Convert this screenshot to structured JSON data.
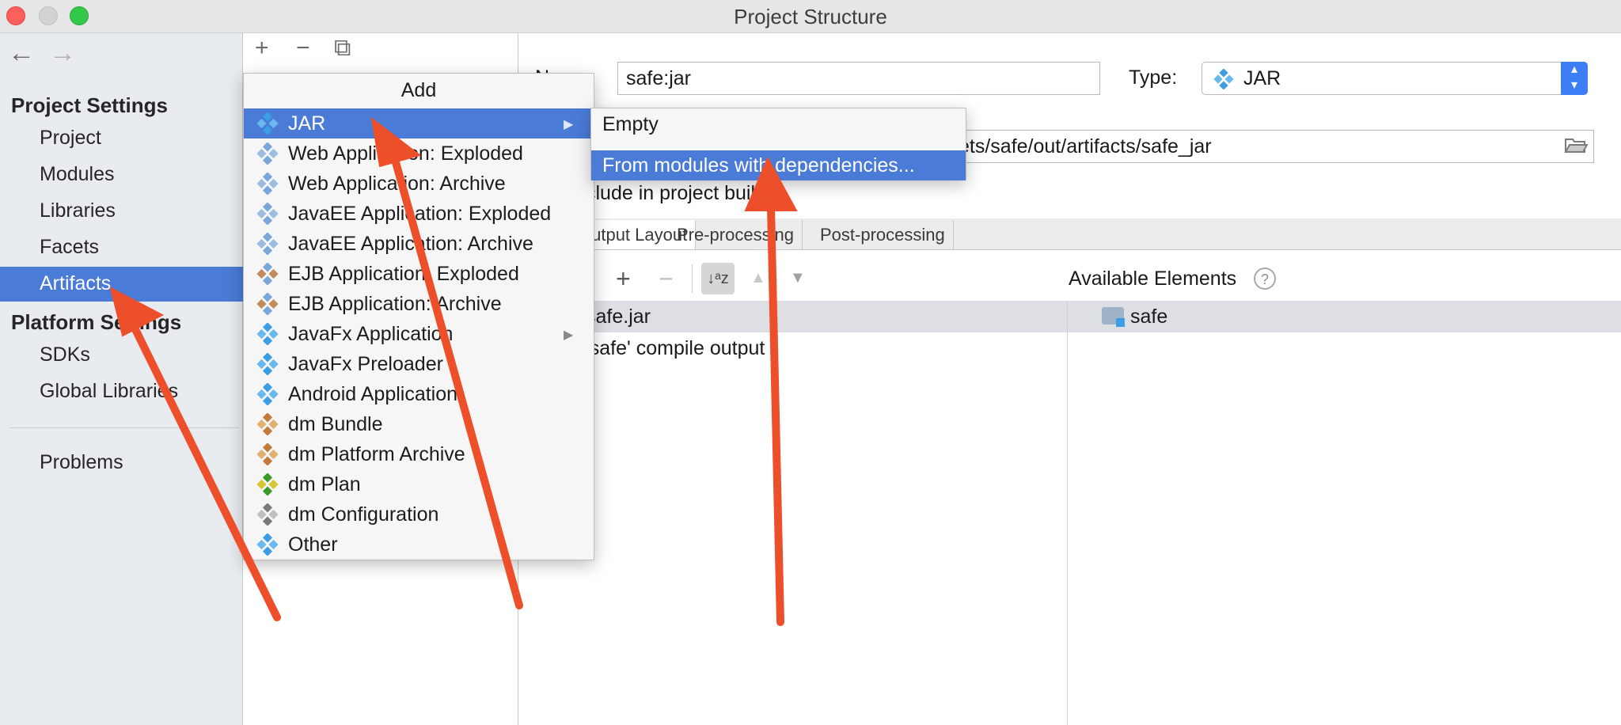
{
  "window": {
    "title": "Project Structure"
  },
  "sidebar": {
    "back_icon": "←",
    "forward_icon": "→",
    "project_settings_header": "Project Settings",
    "project_items": [
      "Project",
      "Modules",
      "Libraries",
      "Facets",
      "Artifacts"
    ],
    "platform_settings_header": "Platform Settings",
    "platform_items": [
      "SDKs",
      "Global Libraries"
    ],
    "problems": "Problems",
    "selected": "Artifacts"
  },
  "middle_toolbar": {
    "add_icon": "+",
    "remove_icon": "−",
    "copy_icon": "⧉"
  },
  "artifact": {
    "name_label": "Name:",
    "name_value": "safe:jar",
    "type_label": "Type:",
    "type_value": "JAR",
    "output_dir_value": "ets/safe/out/artifacts/safe_jar",
    "include_label": "clude in project build",
    "tabs": [
      "Output Layout",
      "Pre-processing",
      "Post-processing"
    ],
    "available_elements_label": "Available Elements",
    "help_icon": "?",
    "tree_jar": "safe.jar",
    "tree_compile": "'safe' compile output",
    "available_item": "safe"
  },
  "add_menu": {
    "title": "Add",
    "items": [
      {
        "label": "JAR",
        "icon": "jar-icon",
        "submenu": true,
        "selected": true
      },
      {
        "label": "Web Application: Exploded",
        "icon": "web-app-icon"
      },
      {
        "label": "Web Application: Archive",
        "icon": "web-app-icon"
      },
      {
        "label": "JavaEE Application: Exploded",
        "icon": "javaee-icon"
      },
      {
        "label": "JavaEE Application: Archive",
        "icon": "javaee-icon"
      },
      {
        "label": "EJB Application: Exploded",
        "icon": "ejb-icon"
      },
      {
        "label": "EJB Application: Archive",
        "icon": "ejb-icon"
      },
      {
        "label": "JavaFx Application",
        "icon": "javafx-icon",
        "submenu": true
      },
      {
        "label": "JavaFx Preloader",
        "icon": "javafx-icon"
      },
      {
        "label": "Android Application",
        "icon": "android-icon"
      },
      {
        "label": "dm Bundle",
        "icon": "dm-bundle-icon"
      },
      {
        "label": "dm Platform Archive",
        "icon": "dm-platform-icon"
      },
      {
        "label": "dm Plan",
        "icon": "dm-plan-icon"
      },
      {
        "label": "dm Configuration",
        "icon": "dm-config-icon"
      },
      {
        "label": "Other",
        "icon": "other-icon"
      }
    ]
  },
  "jar_submenu": {
    "items": [
      {
        "label": "Empty"
      },
      {
        "label": "From modules with dependencies...",
        "selected": true
      }
    ]
  },
  "colors": {
    "selection": "#4a7bd6",
    "annotation_arrow": "#ee4f2b",
    "sidebar_bg": "#e8ecf1"
  }
}
